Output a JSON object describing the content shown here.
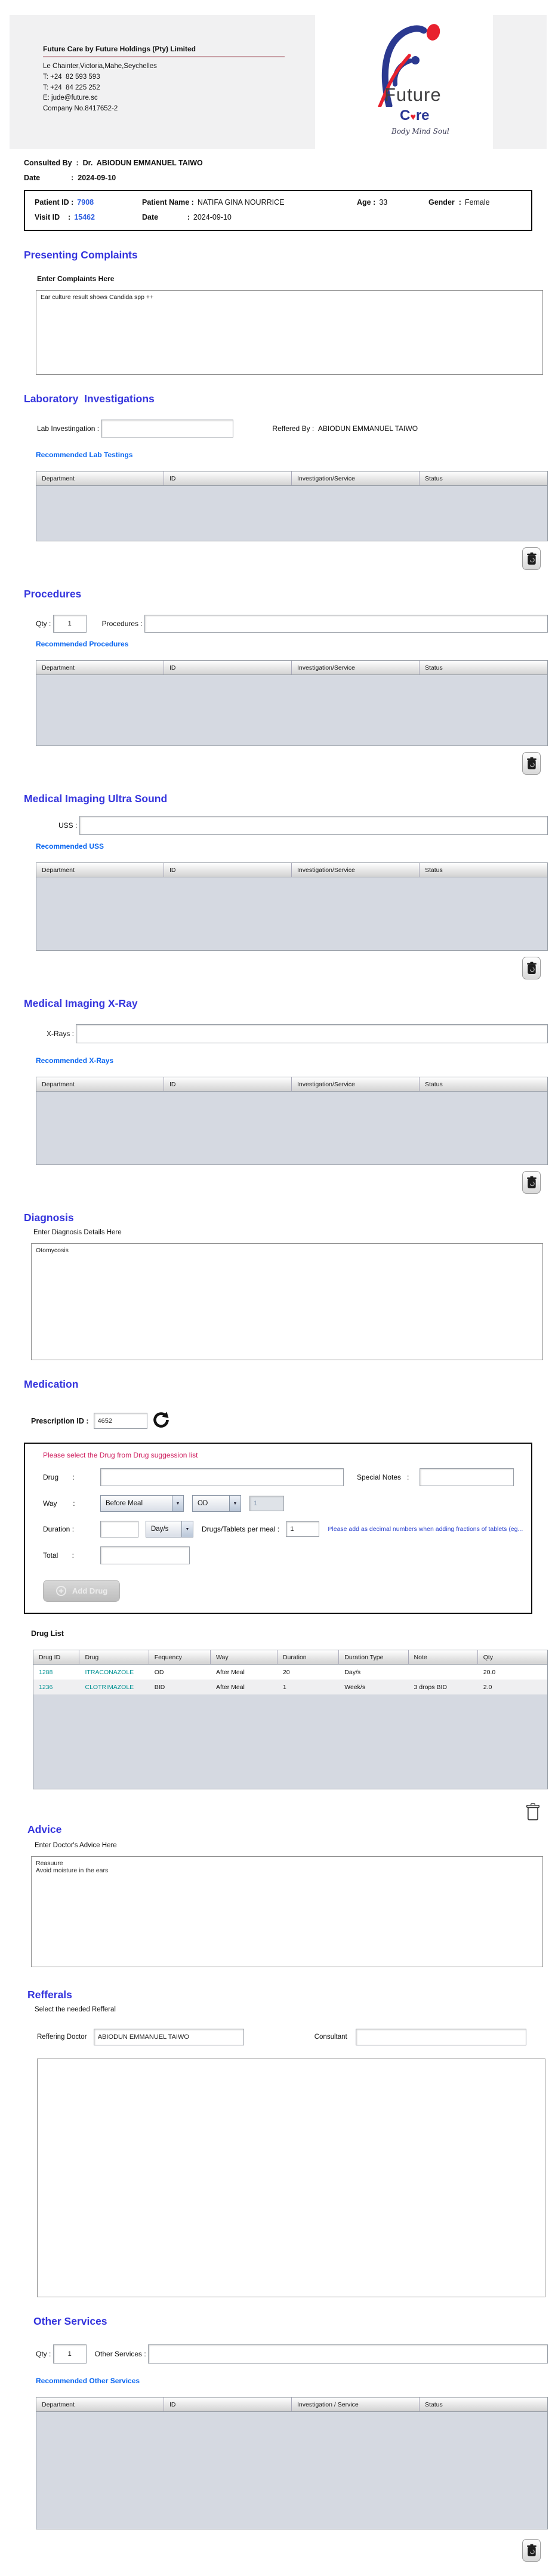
{
  "colors": {
    "section_title_blue": "#3434dd",
    "recommended_link_blue": "#0a66f0",
    "warning_red": "#cf2060",
    "info_note_blue": "#2e45cf",
    "drug_teal": "#009293",
    "id_blue": "#2b5ce0",
    "logo_blue": "#2b3990",
    "logo_red": "#e8212e"
  },
  "icons": {
    "dropdown_arrow": "▼",
    "heart": "♥"
  },
  "header": {
    "company_title": "Future Care by Future Holdings (Pty) Limited",
    "address": "Le Chainter,Victoria,Mahe,Seychelles",
    "phone1": "T: +24  82 593 593",
    "phone2": "T: +24  84 225 252",
    "email": "E: jude@future.sc",
    "company_no": "Company No.8417652-2",
    "logo": {
      "name": "Future",
      "care_parts": [
        "C",
        "re"
      ],
      "tagline": "Body Mind Soul"
    }
  },
  "consultation": {
    "consulted_by_label": "Consulted By  :",
    "consulted_by_value": "  Dr.  ABIODUN EMMANUEL TAIWO",
    "date_label": "Date               :",
    "date_value": "  2024-09-10"
  },
  "patient_box": {
    "patient_id_label": "Patient ID :",
    "patient_id": "7908",
    "patient_name_label": "Patient Name :",
    "patient_name": "NATIFA GINA NOURRICE",
    "age_label": "Age :",
    "age": "33",
    "gender_label": "Gender  :",
    "gender": "Female",
    "visit_id_label": "Visit ID    :",
    "visit_id": "15462",
    "visit_date_label": "Date              :",
    "visit_date": "2024-09-10"
  },
  "presenting_complaints": {
    "title": "Presenting Complaints",
    "sublabel": "Enter Complaints Here",
    "text": "Ear culture result shows Candida spp ++"
  },
  "laboratory": {
    "title": "Laboratory  Investigations",
    "field_label": "Lab Investingation : ",
    "field_value": "",
    "referred_by_label": "Reffered By :  ",
    "referred_by": "ABIODUN EMMANUEL TAIWO",
    "recommended_label": "Recommended Lab Testings",
    "table_headers": [
      "Department",
      "ID",
      "Investigation/Service",
      "Status"
    ]
  },
  "procedures": {
    "title": "Procedures",
    "qty_label": "Qty : ",
    "qty": "1",
    "field_label": "Procedures : ",
    "field_value": "",
    "recommended_label": "Recommended Procedures",
    "table_headers": [
      "Department",
      "ID",
      "Investigation/Service",
      "Status"
    ]
  },
  "uss": {
    "title": "Medical Imaging Ultra Sound",
    "field_label": "USS : ",
    "field_value": "",
    "recommended_label": "Recommended USS",
    "table_headers": [
      "Department",
      "ID",
      "Investigation/Service",
      "Status"
    ]
  },
  "xray": {
    "title": "Medical Imaging X-Ray",
    "field_label": "X-Rays : ",
    "field_value": "",
    "recommended_label": "Recommended X-Rays",
    "table_headers": [
      "Department",
      "ID",
      "Investigation/Service",
      "Status"
    ]
  },
  "diagnosis": {
    "title": "Diagnosis",
    "sublabel": "Enter Diagnosis Details Here",
    "text": "Otomycosis"
  },
  "medication": {
    "title": "Medication",
    "prescription_id_label": "Prescription ID : ",
    "prescription_id": "4652",
    "note": "Please select the Drug from Drug suggession list",
    "drug_label": "Drug       :",
    "drug_value": "",
    "special_notes_label": "Special Notes   :",
    "special_notes_value": "",
    "way_label": "Way        :",
    "meal_select": "Before Meal",
    "freq_select": "OD",
    "way_qty": "1",
    "duration_label": "Duration :",
    "duration_value": "",
    "duration_unit_select": "Day/s",
    "per_meal_label": "Drugs/Tablets per meal : ",
    "per_meal_value": "1",
    "fraction_note": "Please add as decimal numbers when adding fractions of tablets (eg...",
    "total_label": "Total       :",
    "total_value": "",
    "add_drug_label": "Add Drug",
    "drug_list_title": "Drug List",
    "drug_table_headers": [
      "Drug ID",
      "Drug",
      "Fequency",
      "Way",
      "Duration",
      "Duration Type",
      "Note",
      "Qty"
    ],
    "drug_rows": [
      [
        "1288",
        "ITRACONAZOLE",
        "OD",
        "After Meal",
        "20",
        "Day/s",
        "",
        "20.0"
      ],
      [
        "1236",
        "CLOTRIMAZOLE",
        "BID",
        "After Meal",
        "1",
        "Week/s",
        "3 drops BID",
        "2.0"
      ]
    ]
  },
  "advice": {
    "title": "Advice",
    "sublabel": "Enter Doctor's Advice Here",
    "text": "Reasuure\nAvoid moisture in the ears"
  },
  "refferals": {
    "title": "Refferals",
    "sublabel": "Select the needed Refferal",
    "doctor_label": "Reffering Doctor ",
    "doctor_value": "ABIODUN EMMANUEL TAIWO",
    "consultant_label": "Consultant",
    "consultant_value": ""
  },
  "other_services": {
    "title": "Other Services",
    "qty_label": "Qty : ",
    "qty": "1",
    "field_label": "Other Services : ",
    "field_value": "",
    "recommended_label": "Recommended Other Services",
    "table_headers": [
      "Department",
      "ID",
      "Investigation / Service",
      "Status"
    ]
  }
}
